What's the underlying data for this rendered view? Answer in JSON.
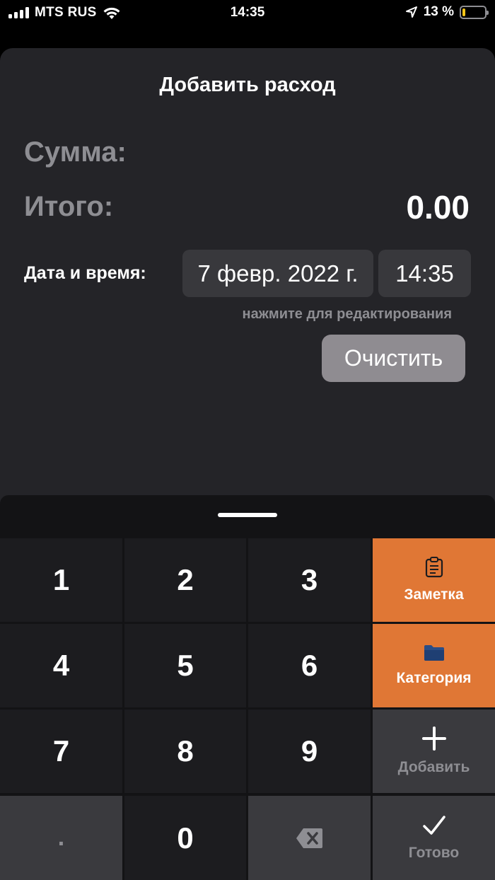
{
  "status_bar": {
    "carrier": "MTS RUS",
    "time": "14:35",
    "battery_text": "13 %",
    "battery_level": 0.13,
    "battery_color": "#f5c518"
  },
  "sheet": {
    "title": "Добавить расход",
    "sum_label": "Сумма:",
    "total_label": "Итого:",
    "total_value": "0.00",
    "datetime_label": "Дата и время:",
    "date_value": "7 февр. 2022 г.",
    "time_value": "14:35",
    "hint": "нажмите для редактирования",
    "clear_label": "Очистить"
  },
  "keypad": {
    "digits": [
      "1",
      "2",
      "3",
      "4",
      "5",
      "6",
      "7",
      "8",
      "9"
    ],
    "dot": ".",
    "zero": "0",
    "note_label": "Заметка",
    "category_label": "Категория",
    "add_label": "Добавить",
    "done_label": "Готово",
    "accent_color": "#e07735"
  }
}
